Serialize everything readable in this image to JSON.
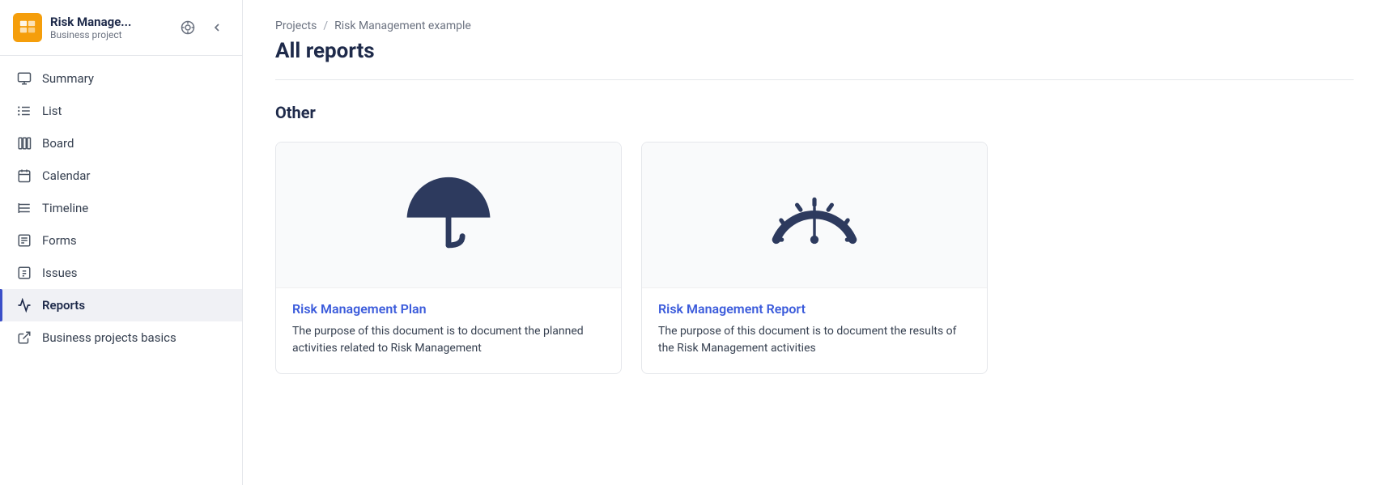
{
  "sidebar": {
    "project_name": "Risk Manage...",
    "project_sub": "Business project",
    "nav_items": [
      {
        "id": "summary",
        "label": "Summary",
        "icon": "summary"
      },
      {
        "id": "list",
        "label": "List",
        "icon": "list"
      },
      {
        "id": "board",
        "label": "Board",
        "icon": "board"
      },
      {
        "id": "calendar",
        "label": "Calendar",
        "icon": "calendar"
      },
      {
        "id": "timeline",
        "label": "Timeline",
        "icon": "timeline"
      },
      {
        "id": "forms",
        "label": "Forms",
        "icon": "forms"
      },
      {
        "id": "issues",
        "label": "Issues",
        "icon": "issues"
      },
      {
        "id": "reports",
        "label": "Reports",
        "icon": "reports"
      },
      {
        "id": "basics",
        "label": "Business projects basics",
        "icon": "external"
      }
    ]
  },
  "breadcrumb": {
    "parent": "Projects",
    "separator": "/",
    "current": "Risk Management example"
  },
  "page": {
    "title": "All reports"
  },
  "section": {
    "title": "Other"
  },
  "cards": [
    {
      "id": "risk-plan",
      "title": "Risk Management Plan",
      "description": "The purpose of this document is to document the planned activities related to Risk Management"
    },
    {
      "id": "risk-report",
      "title": "Risk Management Report",
      "description": "The purpose of this document is to document the results of the Risk Management activities"
    }
  ]
}
